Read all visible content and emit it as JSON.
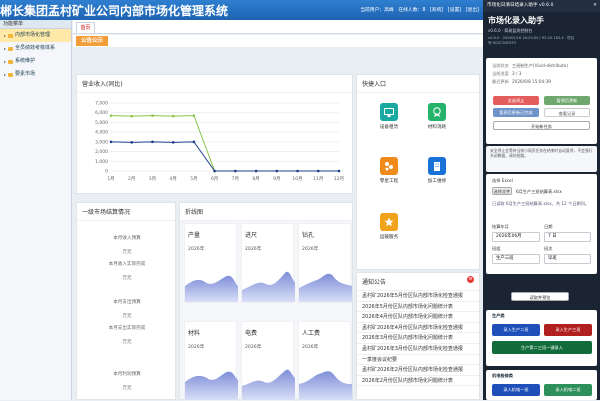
{
  "header": {
    "title": "郴长集团孟村矿业公司内部市场化管理系统",
    "user_label": "当前用户：高峰",
    "online_label": "在线人数：8",
    "links": [
      "[系统]",
      "[设置]",
      "[退出]"
    ]
  },
  "sidebar": {
    "title": "功能菜单",
    "items": [
      {
        "label": "内部市场化管理"
      },
      {
        "label": "全员绩效考核体系"
      },
      {
        "label": "系统维护"
      },
      {
        "label": "要素市场"
      }
    ]
  },
  "tabs": {
    "home": "首页"
  },
  "notice_label": "公告公示",
  "revenue_panel": {
    "title": "营业收入(同比)"
  },
  "chart_data": {
    "type": "line",
    "title": "",
    "xlabel": "",
    "ylabel": "",
    "categories": [
      "1月",
      "2月",
      "3月",
      "4月",
      "5月",
      "6月",
      "7月",
      "8月",
      "9月",
      "10月",
      "11月",
      "12月"
    ],
    "series": [
      {
        "name": "",
        "color": "#8bc34a",
        "values": [
          5700,
          5650,
          5700,
          5650,
          5700,
          0,
          0,
          0,
          0,
          0,
          0,
          0
        ]
      },
      {
        "name": "",
        "color": "#1e3f8c",
        "values": [
          3000,
          2950,
          3000,
          2950,
          3000,
          0,
          0,
          0,
          0,
          0,
          0,
          0
        ]
      }
    ],
    "ylim": [
      0,
      7000
    ],
    "yticks": [
      "7,000",
      "6,000",
      "5,000",
      "4,000",
      "3,000",
      "2,000",
      "1,000",
      "0"
    ],
    "grid": true
  },
  "quick": {
    "title": "快捷入口",
    "items": [
      {
        "label": "设备租赁",
        "color": "#1aa9a0"
      },
      {
        "label": "材料消耗",
        "color": "#25b36a"
      },
      {
        "label": "零星工程",
        "color": "#f08a1a"
      },
      {
        "label": "加工维修",
        "color": "#1a72d8"
      },
      {
        "label": "运输服务",
        "color": "#f0a21a"
      }
    ]
  },
  "settle": {
    "title": "一级市场结算情况",
    "rows": [
      {
        "label": "本月收入预算",
        "value": "万元"
      },
      {
        "label": "本月收入实际完成",
        "value": "万元"
      },
      {
        "label": "本月支出预算",
        "value": "万元"
      },
      {
        "label": "本月支出实际完成",
        "value": "万元"
      },
      {
        "label": "本月利润预算",
        "value": "万元"
      }
    ]
  },
  "minis": {
    "title": "折线图",
    "items": [
      {
        "name": "产量",
        "year": "2026年"
      },
      {
        "name": "进尺",
        "year": "2026年"
      },
      {
        "name": "钻孔",
        "year": "2026年"
      },
      {
        "name": "材料",
        "year": "2026年"
      },
      {
        "name": "电费",
        "year": "2026年"
      },
      {
        "name": "人工费",
        "year": "2026年"
      }
    ]
  },
  "notices": {
    "title": "通知公告",
    "items": [
      "孟村矿2026年5月份区队内部市场化检查通报",
      "2026年5月份区队内部市场化问题统计表",
      "2026年4月份区队内部市场化问题统计表",
      "孟村矿2026年4月份区队内部市场化检查通报",
      "2026年3月份区队内部市场化问题统计表",
      "孟村矿2026年3月份区队内部市场化检查通报",
      "一季度会议纪要",
      "孟村矿2026年2月份区队内部市场化检查通报",
      "2026年2月份区队内部市场化问题统计表"
    ]
  },
  "assistant": {
    "window_title": "市场化日清日结录入助手 v0.6.0",
    "title": "市场化录入助手",
    "version": "v0.6.0 · 简易监测控制台",
    "build": "v0.6.0 · 2026/5/16 16:29:05 / 95.20.183.4 · 项目号:9D2C50EEF5",
    "kv": [
      {
        "k": "当前状态",
        "v": "三班制生产(Vivid-distribute)"
      },
      {
        "k": "当前进度",
        "v": "3 / 3"
      },
      {
        "k": "最近更新",
        "v": "2026/6/8 15:04:39"
      }
    ],
    "buttons": [
      "全选停止",
      "暂停后更新",
      "暂停后更新已完成",
      "查看记录"
    ],
    "start_label": "开始新任务",
    "hint": "安全停止会等待当前小网页任务在结束时自动暂停，不会强行关闭数据，请勿抢路。",
    "excel_title": "选择 Excel",
    "file_button": "选择文件",
    "file_name": "6月生产三班结算表.xlsx",
    "file_info": "已读取 6月生产三班结算表.xlsx，共 12 个日期列。",
    "month_label": "结算年月",
    "month_value": "2026年06月",
    "day_label": "日期",
    "day_value": "7 日",
    "team_label": "班组",
    "team_value": "生产三班",
    "type_label": "班次",
    "type_value": "早班",
    "read_button": "读取并预览",
    "prod_title": "生产类",
    "prod_buttons": [
      "录入生产二班",
      "录入生产三班",
      "生产第二三班一键录入"
    ],
    "mech_title": "机电检修类",
    "mech_buttons": [
      "录入机电一班",
      "录入机电二班"
    ]
  }
}
